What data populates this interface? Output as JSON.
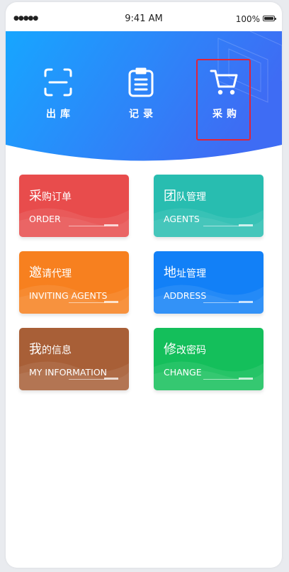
{
  "status_bar": {
    "signal": "●●●●●",
    "time": "9:41 AM",
    "battery": "100%"
  },
  "header": {
    "actions": [
      {
        "label": "出库",
        "icon": "scan-icon"
      },
      {
        "label": "记录",
        "icon": "clipboard-icon"
      },
      {
        "label": "采购",
        "icon": "cart-icon"
      }
    ]
  },
  "menu": [
    {
      "title_first": "采",
      "title_rest": "购订单",
      "subtitle": "ORDER",
      "color_top": "#f25a5a",
      "color_bottom": "#e34848"
    },
    {
      "title_first": "团",
      "title_rest": "队管理",
      "subtitle": "AGENTS",
      "color_top": "#33c6b9",
      "color_bottom": "#22b5a8"
    },
    {
      "title_first": "邀",
      "title_rest": "请代理",
      "subtitle": "INVITING AGENTS",
      "color_top": "#ff8a2a",
      "color_bottom": "#f2761a"
    },
    {
      "title_first": "地",
      "title_rest": "址管理",
      "subtitle": "ADDRESS",
      "color_top": "#1a8bff",
      "color_bottom": "#0b76f0"
    },
    {
      "title_first": "我",
      "title_rest": "的信息",
      "subtitle": "MY INFORMATION",
      "color_top": "#b36a3f",
      "color_bottom": "#9b5530"
    },
    {
      "title_first": "修",
      "title_rest": "改密码",
      "subtitle": "CHANGE",
      "color_top": "#1ec964",
      "color_bottom": "#0db655"
    }
  ],
  "colors": {
    "banner_start": "#1aa4ff",
    "banner_end": "#3b6ff5",
    "highlight": "#e0243a"
  }
}
